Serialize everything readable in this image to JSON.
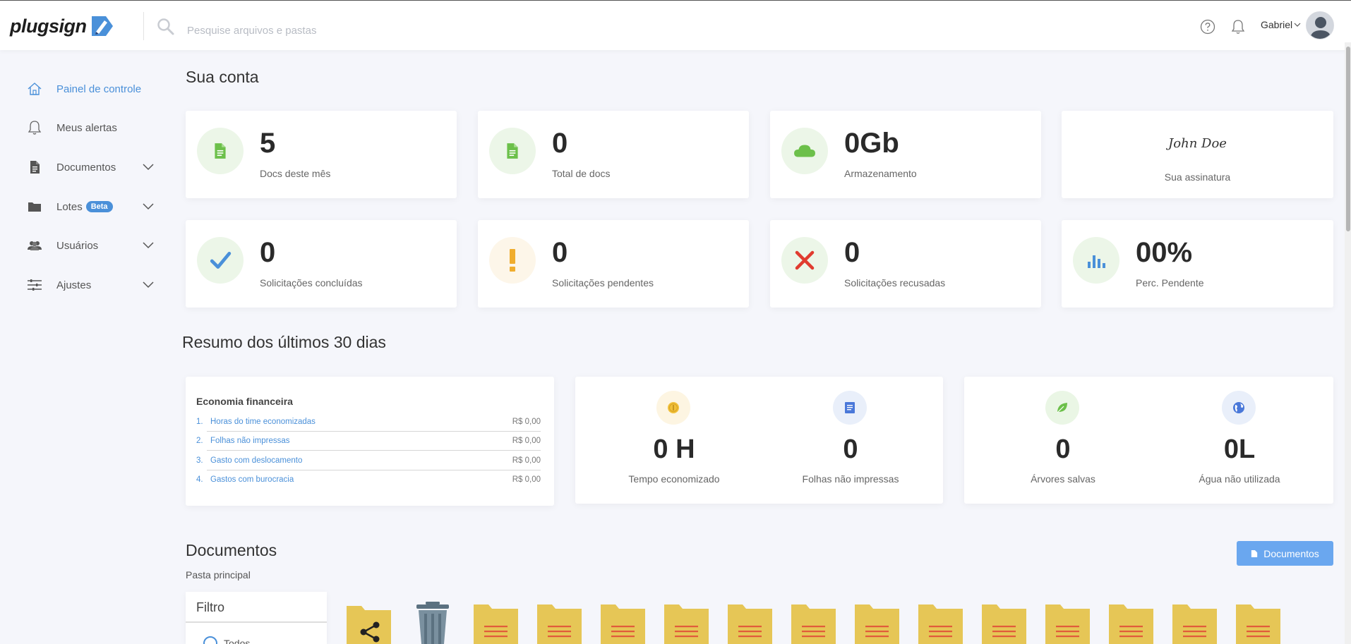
{
  "header": {
    "logo_text": "plugsign",
    "search_placeholder": "Pesquise arquivos e pastas",
    "user_name": "Gabriel"
  },
  "sidebar": {
    "items": [
      {
        "label": "Painel de controle"
      },
      {
        "label": "Meus alertas"
      },
      {
        "label": "Documentos"
      },
      {
        "label": "Lotes",
        "badge": "Beta"
      },
      {
        "label": "Usuários"
      },
      {
        "label": "Ajustes"
      }
    ]
  },
  "account": {
    "title": "Sua conta",
    "stats": [
      {
        "value": "5",
        "label": "Docs deste mês"
      },
      {
        "value": "0",
        "label": "Total de docs"
      },
      {
        "value": "0Gb",
        "label": "Armazenamento"
      },
      {
        "value": "0",
        "label": "Solicitações concluídas"
      },
      {
        "value": "0",
        "label": "Solicitações pendentes"
      },
      {
        "value": "0",
        "label": "Solicitações recusadas"
      },
      {
        "value": "00%",
        "label": "Perc. Pendente"
      }
    ],
    "signature": {
      "name": "John Doe",
      "label": "Sua assinatura"
    }
  },
  "summary": {
    "title": "Resumo dos últimos 30 dias",
    "financial": {
      "title": "Economia financeira",
      "rows": [
        {
          "num": "1.",
          "name": "Horas do time economizadas",
          "value": "R$ 0,00"
        },
        {
          "num": "2.",
          "name": "Folhas não impressas",
          "value": "R$ 0,00"
        },
        {
          "num": "3.",
          "name": "Gasto com deslocamento",
          "value": "R$ 0,00"
        },
        {
          "num": "4.",
          "name": "Gastos com burocracia",
          "value": "R$ 0,00"
        }
      ]
    },
    "metrics": [
      {
        "value": "0 H",
        "label": "Tempo economizado"
      },
      {
        "value": "0",
        "label": "Folhas não impressas"
      },
      {
        "value": "0",
        "label": "Árvores salvas"
      },
      {
        "value": "0L",
        "label": "Água não utilizada"
      }
    ]
  },
  "documents": {
    "title": "Documentos",
    "subtitle": "Pasta principal",
    "button_label": "Documentos",
    "filter_title": "Filtro",
    "filter_option": "Todos"
  },
  "colors": {
    "accent": "#4a90d9",
    "button": "#6aa7ef",
    "success": "#6cc04a",
    "warning": "#f0ad2e",
    "danger": "#e03b2f",
    "folder": "#e6c656"
  }
}
